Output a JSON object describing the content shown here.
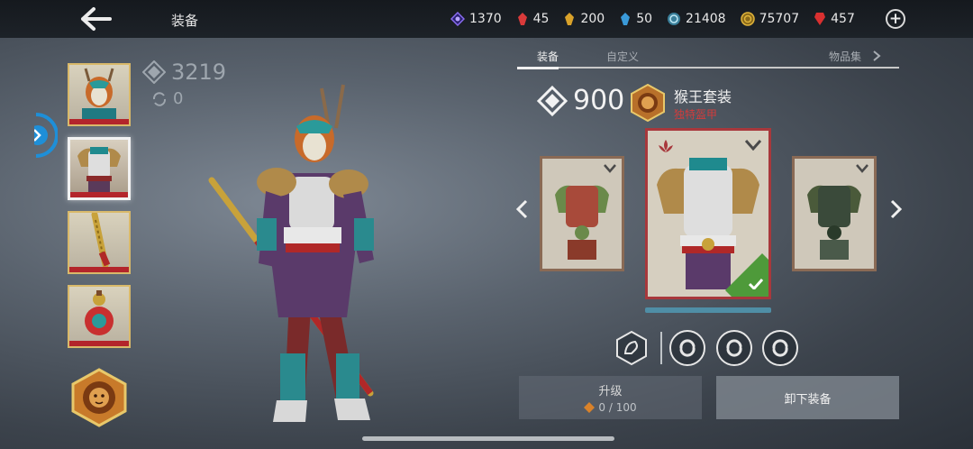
{
  "header": {
    "back_icon": "arrow-left-icon",
    "title": "装备"
  },
  "currencies": [
    {
      "icon": "purple-gem-icon",
      "color": "#8a6cf0",
      "value": "1370"
    },
    {
      "icon": "red-crystal-icon",
      "color": "#d93a3a",
      "value": "45"
    },
    {
      "icon": "gold-crystal-icon",
      "color": "#d9a22a",
      "value": "200"
    },
    {
      "icon": "blue-crystal-icon",
      "color": "#3a9ad9",
      "value": "50"
    },
    {
      "icon": "swirl-token-icon",
      "color": "#5ab0d0",
      "value": "21408"
    },
    {
      "icon": "gold-coin-icon",
      "color": "#e0b43a",
      "value": "75707"
    },
    {
      "icon": "red-gem-icon",
      "color": "#d93030",
      "value": "457"
    }
  ],
  "left_panel": {
    "power": "3219",
    "upgrade": "0",
    "slots": [
      "helmet",
      "armor",
      "weapon",
      "consumable"
    ],
    "selected_slot": "armor"
  },
  "tabs": [
    {
      "label": "装备",
      "active": true
    },
    {
      "label": "自定义",
      "active": false
    },
    {
      "label": "物品集",
      "active": false
    }
  ],
  "item": {
    "power": "900",
    "set_name": "猴王套装",
    "rarity": "独特盔甲"
  },
  "buttons": {
    "upgrade_label": "升级",
    "upgrade_progress": "0 / 100",
    "unequip_label": "卸下装备"
  },
  "colors": {
    "accent_gold": "#d9b96a",
    "rarity_red": "#a8383c",
    "equipped_green": "#4e9a3a",
    "side_tab_blue": "#1e8fd8"
  }
}
